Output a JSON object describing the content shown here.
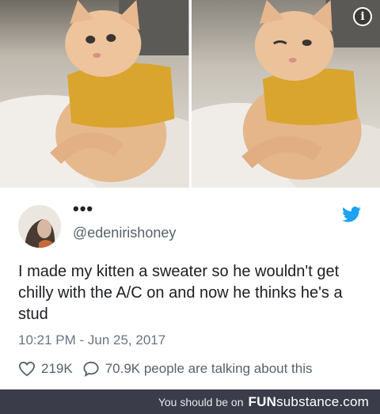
{
  "photos": [
    {
      "alt": "kitten-in-yellow-sweater-left"
    },
    {
      "alt": "kitten-in-yellow-sweater-right"
    }
  ],
  "tweet": {
    "name_placeholder": "•••",
    "handle": "@edenirishoney",
    "text": "I made my kitten a sweater so he wouldn't get chilly with the A/C on and now he thinks he's a stud",
    "timestamp": "10:21 PM - Jun 25, 2017",
    "likes": "219K",
    "replies": "70.9K people are talking about this"
  },
  "footer": {
    "prefix": "You should be on",
    "brand_bold": "FUN",
    "brand_rest": "substance.com"
  },
  "colors": {
    "twitter_blue": "#1da1f2",
    "footer_bg": "#3b3c4a",
    "sweater_yellow": "#d9a52e"
  }
}
